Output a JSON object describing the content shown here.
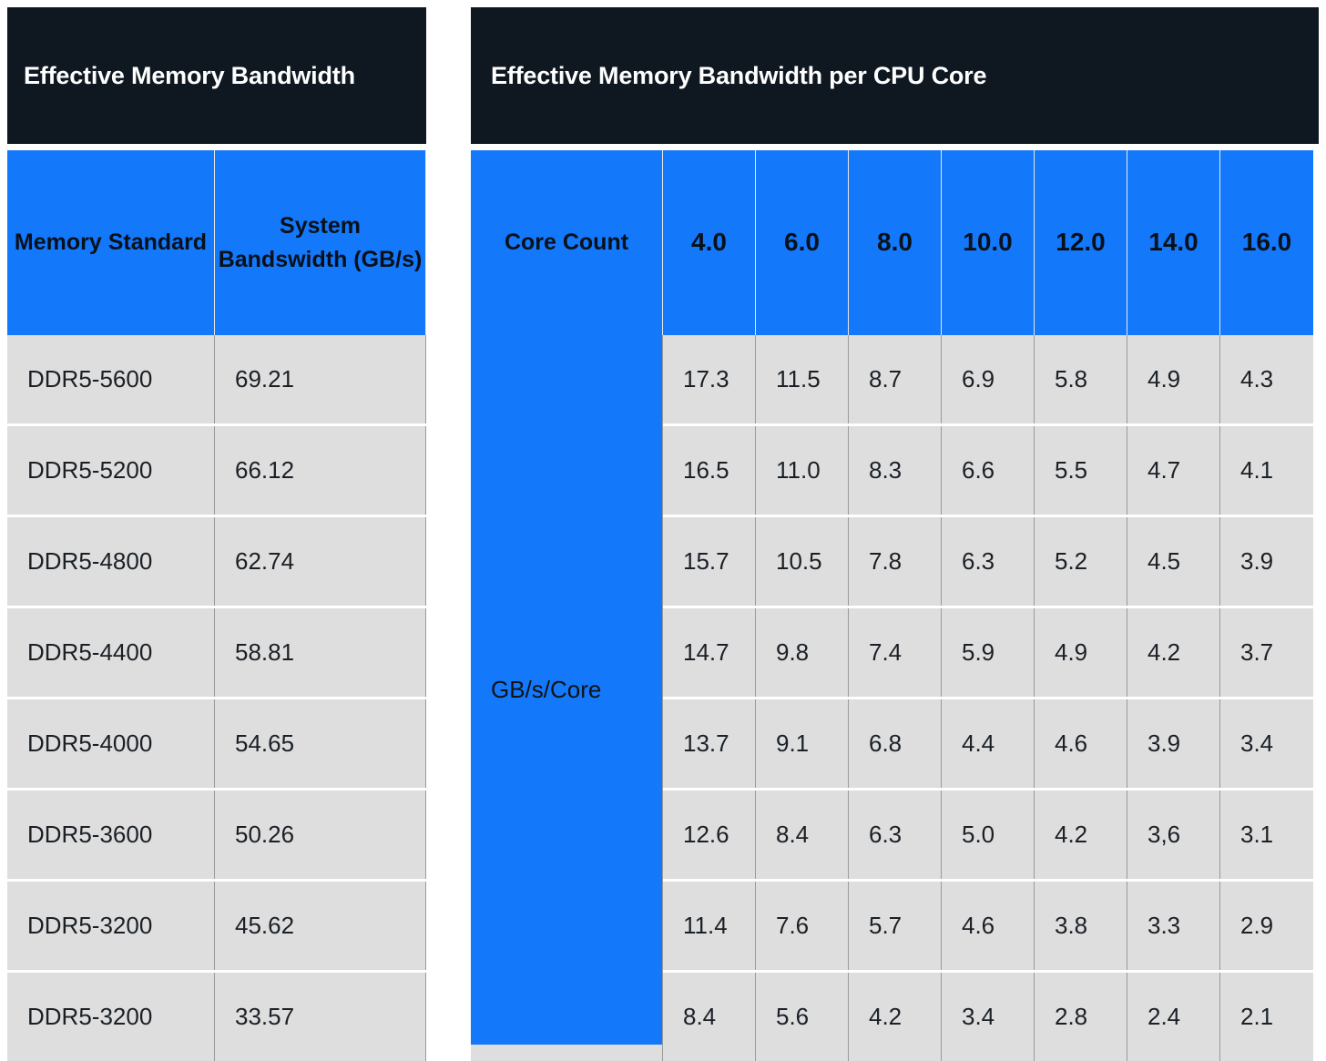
{
  "header": {
    "left_title": "Effective Memory Bandwidth",
    "right_title": "Effective Memory Bandwidth per CPU Core"
  },
  "colors": {
    "accent_blue": "#1478fb",
    "header_dark": "#0f1720",
    "cell_gray": "#dedede",
    "text_dark": "#1b2026"
  },
  "columns": {
    "memory_standard": "Memory Standard",
    "system_bandwidth": "System Bandswidth (GB/s)",
    "core_count": "Core Count",
    "unit_label": "GB/s/Core",
    "core_counts": [
      "4.0",
      "6.0",
      "8.0",
      "10.0",
      "12.0",
      "14.0",
      "16.0"
    ]
  },
  "chart_data": {
    "type": "table",
    "title": "Effective Memory Bandwidth per CPU Core",
    "xlabel": "Core Count",
    "ylabel": "Memory Standard",
    "unit": "GB/s/Core",
    "categories": [
      "4.0",
      "6.0",
      "8.0",
      "10.0",
      "12.0",
      "14.0",
      "16.0"
    ],
    "series": [
      {
        "name": "DDR5-5600",
        "system_bandwidth": 69.21,
        "values": [
          17.3,
          11.5,
          8.7,
          6.9,
          5.8,
          4.9,
          4.3
        ]
      },
      {
        "name": "DDR5-5200",
        "system_bandwidth": 66.12,
        "values": [
          16.5,
          11.0,
          8.3,
          6.6,
          5.5,
          4.7,
          4.1
        ]
      },
      {
        "name": "DDR5-4800",
        "system_bandwidth": 62.74,
        "values": [
          15.7,
          10.5,
          7.8,
          6.3,
          5.2,
          4.5,
          3.9
        ]
      },
      {
        "name": "DDR5-4400",
        "system_bandwidth": 58.81,
        "values": [
          14.7,
          9.8,
          7.4,
          5.9,
          4.9,
          4.2,
          3.7
        ]
      },
      {
        "name": "DDR5-4000",
        "system_bandwidth": 54.65,
        "values": [
          13.7,
          9.1,
          6.8,
          4.4,
          4.6,
          3.9,
          3.4
        ]
      },
      {
        "name": "DDR5-3600",
        "system_bandwidth": 50.26,
        "values": [
          12.6,
          8.4,
          6.3,
          5.0,
          4.2,
          3.6,
          3.1
        ]
      },
      {
        "name": "DDR5-3200",
        "system_bandwidth": 45.62,
        "values": [
          11.4,
          7.6,
          5.7,
          4.6,
          3.8,
          3.3,
          2.9
        ]
      },
      {
        "name": "DDR5-3200",
        "system_bandwidth": 33.57,
        "values": [
          8.4,
          5.6,
          4.2,
          3.4,
          2.8,
          2.4,
          2.1
        ]
      }
    ]
  },
  "rows": [
    {
      "standard": "DDR5-5600",
      "bandwidth": "69.21",
      "cells": [
        "17.3",
        "11.5",
        "8.7",
        "6.9",
        "5.8",
        "4.9",
        "4.3"
      ]
    },
    {
      "standard": "DDR5-5200",
      "bandwidth": "66.12",
      "cells": [
        "16.5",
        "11.0",
        "8.3",
        "6.6",
        "5.5",
        "4.7",
        "4.1"
      ]
    },
    {
      "standard": "DDR5-4800",
      "bandwidth": "62.74",
      "cells": [
        "15.7",
        "10.5",
        "7.8",
        "6.3",
        "5.2",
        "4.5",
        "3.9"
      ]
    },
    {
      "standard": "DDR5-4400",
      "bandwidth": "58.81",
      "cells": [
        "14.7",
        "9.8",
        "7.4",
        "5.9",
        "4.9",
        "4.2",
        "3.7"
      ]
    },
    {
      "standard": "DDR5-4000",
      "bandwidth": "54.65",
      "cells": [
        "13.7",
        "9.1",
        "6.8",
        "4.4",
        "4.6",
        "3.9",
        "3.4"
      ]
    },
    {
      "standard": "DDR5-3600",
      "bandwidth": "50.26",
      "cells": [
        "12.6",
        "8.4",
        "6.3",
        "5.0",
        "4.2",
        "3,6",
        "3.1"
      ]
    },
    {
      "standard": "DDR5-3200",
      "bandwidth": "45.62",
      "cells": [
        "11.4",
        "7.6",
        "5.7",
        "4.6",
        "3.8",
        "3.3",
        "2.9"
      ]
    },
    {
      "standard": "DDR5-3200",
      "bandwidth": "33.57",
      "cells": [
        "8.4",
        "5.6",
        "4.2",
        "3.4",
        "2.8",
        "2.4",
        "2.1"
      ]
    }
  ]
}
